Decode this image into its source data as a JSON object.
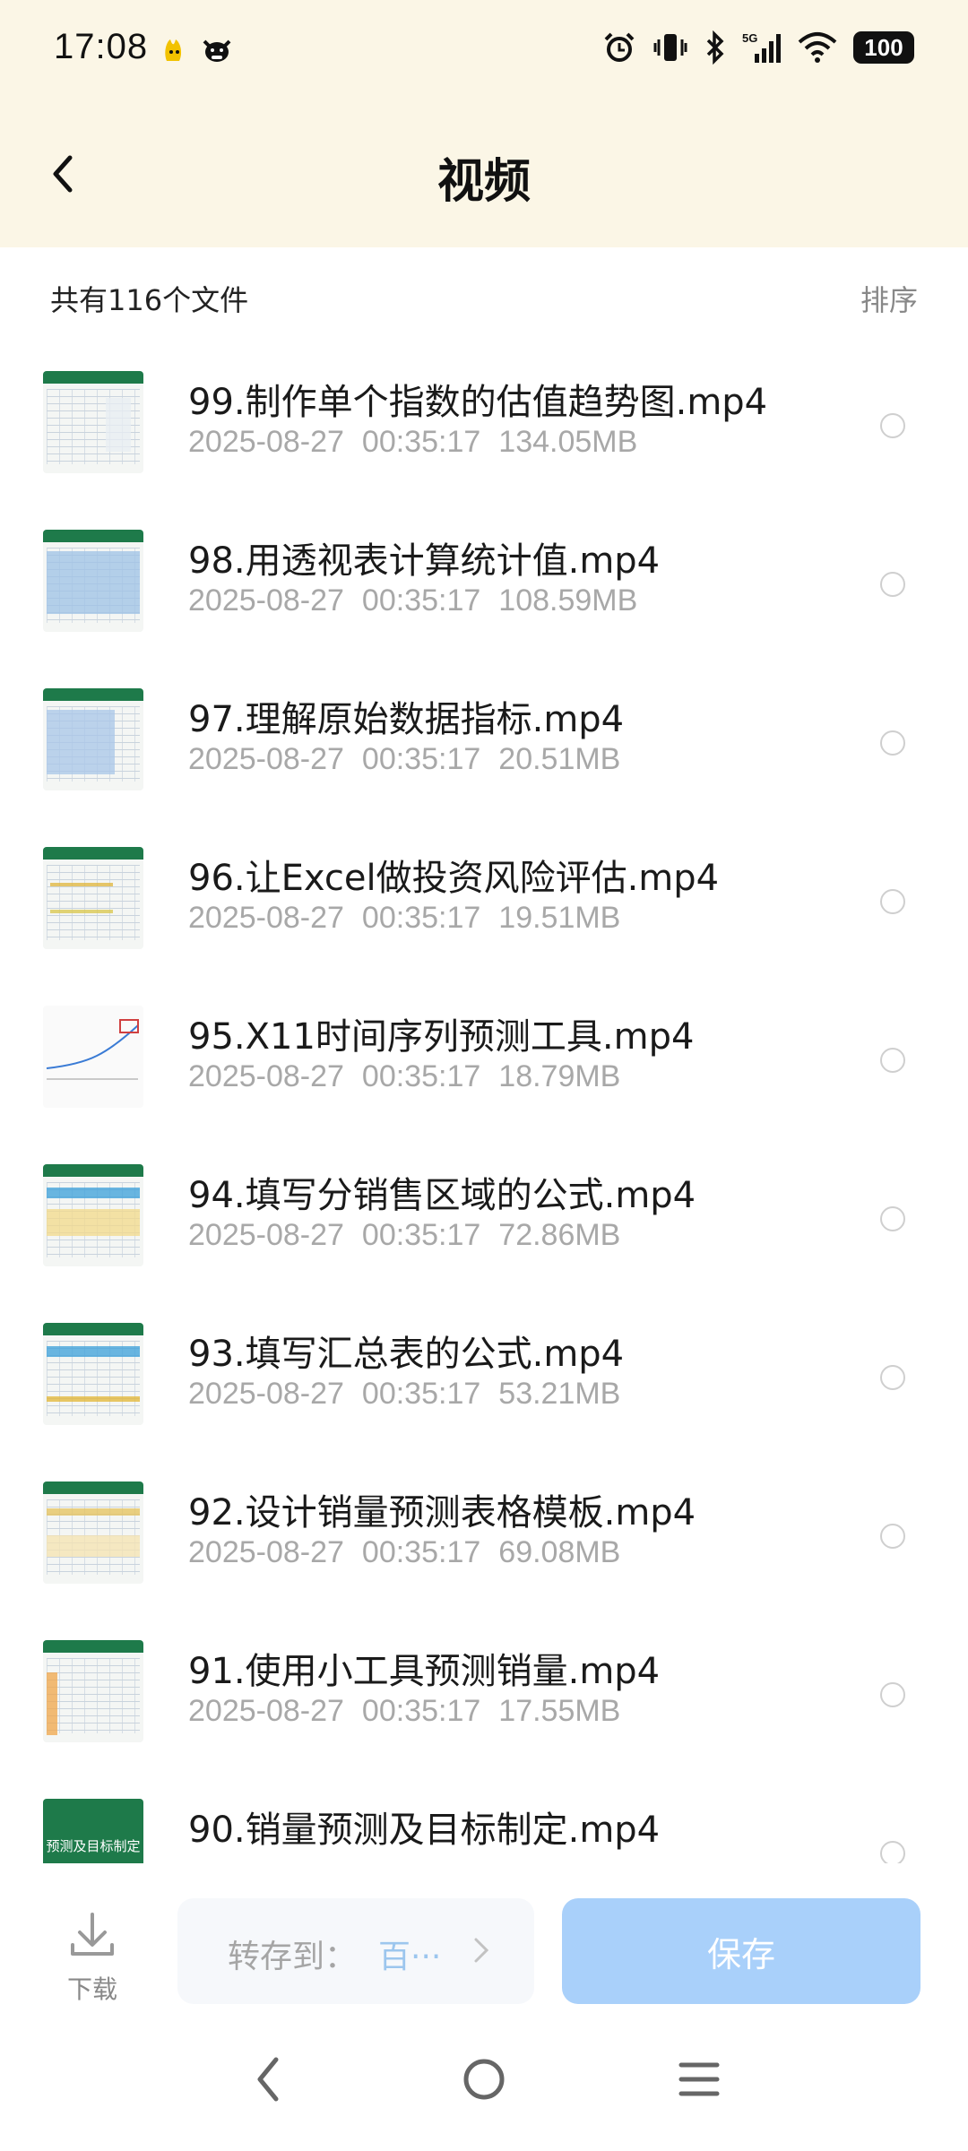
{
  "status_bar": {
    "time": "17:08",
    "battery": "100",
    "icons": [
      "alarm-icon",
      "vibrate-icon",
      "bluetooth-icon",
      "signal-5g-icon",
      "wifi-icon"
    ]
  },
  "header": {
    "title": "视频",
    "back_icon": "chevron-left-icon"
  },
  "summary": {
    "count_text": "共有116个文件",
    "sort_label": "排序"
  },
  "files": [
    {
      "name": "99.制作单个指数的估值趋势图.mp4",
      "date": "2025-08-27",
      "time": "00:35:17",
      "size": "134.05MB"
    },
    {
      "name": "98.用透视表计算统计值.mp4",
      "date": "2025-08-27",
      "time": "00:35:17",
      "size": "108.59MB"
    },
    {
      "name": "97.理解原始数据指标.mp4",
      "date": "2025-08-27",
      "time": "00:35:17",
      "size": "20.51MB"
    },
    {
      "name": "96.让Excel做投资风险评估.mp4",
      "date": "2025-08-27",
      "time": "00:35:17",
      "size": "19.51MB"
    },
    {
      "name": "95.X11时间序列预测工具.mp4",
      "date": "2025-08-27",
      "time": "00:35:17",
      "size": "18.79MB"
    },
    {
      "name": "94.填写分销售区域的公式.mp4",
      "date": "2025-08-27",
      "time": "00:35:17",
      "size": "72.86MB"
    },
    {
      "name": "93.填写汇总表的公式.mp4",
      "date": "2025-08-27",
      "time": "00:35:17",
      "size": "53.21MB"
    },
    {
      "name": "92.设计销量预测表格模板.mp4",
      "date": "2025-08-27",
      "time": "00:35:17",
      "size": "69.08MB"
    },
    {
      "name": "91.使用小工具预测销量.mp4",
      "date": "2025-08-27",
      "time": "00:35:17",
      "size": "17.55MB"
    },
    {
      "name": "90.销量预测及目标制定.mp4",
      "date": "",
      "time": "",
      "size": "",
      "thumb_text": "预测及目标制定"
    }
  ],
  "bottom_bar": {
    "download_label": "下载",
    "save_to_label": "转存到：",
    "save_to_value": "百···",
    "save_button": "保存"
  },
  "colors": {
    "header_bg": "#fbf6e6",
    "save_button_bg": "#a9d0fa",
    "meta_text": "#a8a8a8"
  }
}
